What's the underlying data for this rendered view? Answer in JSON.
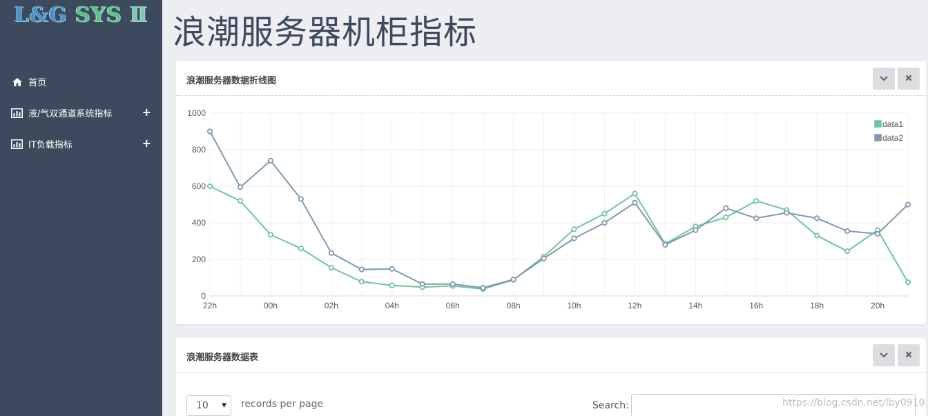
{
  "sidebar": {
    "logo": "L&G SYS Ⅱ",
    "items": [
      {
        "label": "首页",
        "icon": "home-icon",
        "expandable": false
      },
      {
        "label": "液/气双通道系统指标",
        "icon": "bar-chart-icon",
        "expandable": true,
        "expand_symbol": "+"
      },
      {
        "label": "IT负载指标",
        "icon": "bar-chart-icon",
        "expandable": true,
        "expand_symbol": "+"
      }
    ]
  },
  "page": {
    "title": "浪潮服务器机柜指标"
  },
  "chart_panel": {
    "title": "浪潮服务器数据折线图",
    "collapse_icon": "chevron-down-icon",
    "close_icon": "close-icon"
  },
  "table_panel": {
    "title": "浪潮服务器数据表",
    "collapse_icon": "chevron-down-icon",
    "close_icon": "close-icon",
    "length_value": "10",
    "length_label": "records per page",
    "search_label": "Search:",
    "search_value": ""
  },
  "watermark": "https://blog.csdn.net/lby0910",
  "colors": {
    "sidebar": "#3d4a5d",
    "data1": "#6cc5a0",
    "data2": "#8197ae",
    "title": "#3d4a5d"
  },
  "chart_data": {
    "type": "line",
    "x": [
      "22h",
      "23h",
      "00h",
      "01h",
      "02h",
      "03h",
      "04h",
      "05h",
      "06h",
      "07h",
      "08h",
      "09h",
      "10h",
      "11h",
      "12h",
      "13h",
      "14h",
      "15h",
      "16h",
      "17h",
      "18h",
      "19h",
      "20h",
      "21h"
    ],
    "x_tick_labels": [
      "22h",
      "00h",
      "02h",
      "04h",
      "06h",
      "08h",
      "10h",
      "12h",
      "14h",
      "16h",
      "18h",
      "20h"
    ],
    "ylim": [
      0,
      1000
    ],
    "y_ticks": [
      0,
      200,
      400,
      600,
      800,
      1000
    ],
    "grid": true,
    "legend_position": "top-right",
    "series": [
      {
        "name": "data1",
        "color": "#6cc5a0",
        "values": [
          600,
          520,
          335,
          260,
          155,
          78,
          58,
          48,
          55,
          38,
          88,
          215,
          365,
          450,
          560,
          285,
          380,
          430,
          520,
          470,
          330,
          245,
          360,
          75
        ]
      },
      {
        "name": "data2",
        "color": "#8197ae",
        "values": [
          900,
          595,
          740,
          530,
          235,
          145,
          148,
          65,
          65,
          45,
          90,
          205,
          315,
          400,
          510,
          280,
          360,
          480,
          425,
          455,
          425,
          355,
          340,
          500
        ]
      }
    ]
  }
}
